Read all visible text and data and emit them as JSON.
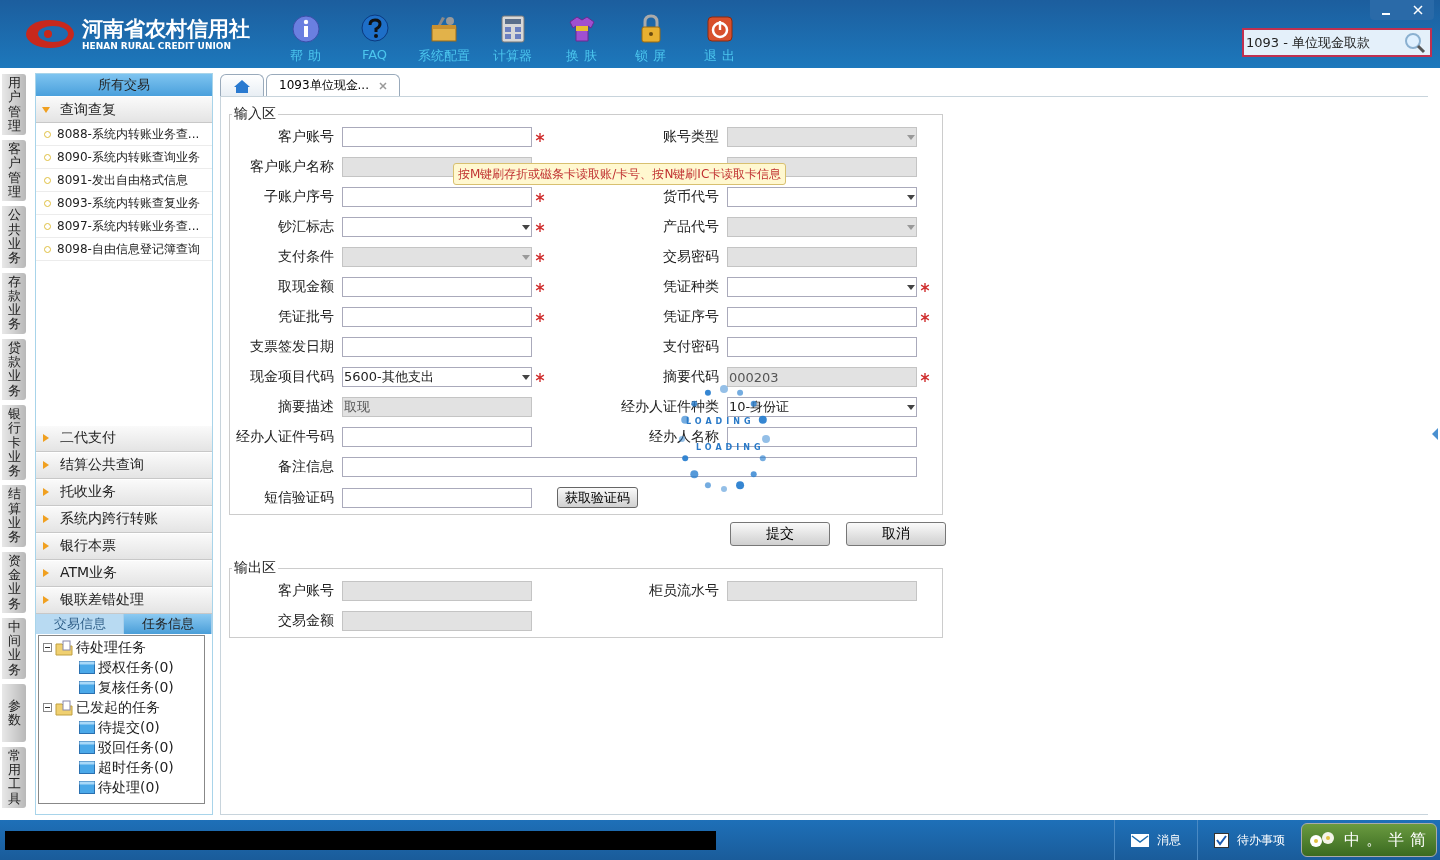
{
  "header": {
    "logo": {
      "title": "河南省农村信用社",
      "subtitle": "HENAN RURAL CREDIT UNION"
    },
    "toolbar": [
      {
        "kind": "info",
        "label": "帮 助"
      },
      {
        "kind": "faq",
        "label": "FAQ"
      },
      {
        "kind": "config",
        "label": "系统配置"
      },
      {
        "kind": "calculator",
        "label": "计算器"
      },
      {
        "kind": "skin",
        "label": "换 肤"
      },
      {
        "kind": "lock",
        "label": "锁 屏"
      },
      {
        "kind": "exit",
        "label": "退 出"
      }
    ],
    "search": {
      "value": "1093 - 单位现金取款"
    }
  },
  "nav_tabs": [
    "用户管理",
    "客户管理",
    "公共业务",
    "存款业务",
    "贷款业务",
    "银行卡业务",
    "结算业务",
    "资金业务",
    "中间业务",
    "参数",
    "常用工具"
  ],
  "sidebar": {
    "title": "所有交易",
    "groups": [
      {
        "label": "查询查复",
        "expanded": true,
        "items": [
          "8088-系统内转账业务查...",
          "8090-系统内转账查询业务",
          "8091-发出自由格式信息",
          "8093-系统内转账查复业务",
          "8097-系统内转账业务查...",
          "8098-自由信息登记簿查询"
        ]
      },
      {
        "label": "二代支付",
        "expanded": false
      },
      {
        "label": "结算公共查询",
        "expanded": false
      },
      {
        "label": "托收业务",
        "expanded": false
      },
      {
        "label": "系统内跨行转账",
        "expanded": false
      },
      {
        "label": "银行本票",
        "expanded": false
      },
      {
        "label": "ATM业务",
        "expanded": false
      },
      {
        "label": "银联差错处理",
        "expanded": false
      }
    ],
    "info_tabs": [
      {
        "label": "交易信息",
        "selected": false
      },
      {
        "label": "任务信息",
        "selected": true
      }
    ],
    "tree": [
      {
        "label": "待处理任务",
        "expanded": true,
        "children": [
          {
            "label": "授权任务(0)"
          },
          {
            "label": "复核任务(0)"
          }
        ]
      },
      {
        "label": "已发起的任务",
        "expanded": true,
        "children": [
          {
            "label": "待提交(0)"
          },
          {
            "label": "驳回任务(0)"
          },
          {
            "label": "超时任务(0)"
          },
          {
            "label": "待处理(0)"
          }
        ]
      }
    ]
  },
  "tabs": [
    {
      "kind": "home",
      "selected": false
    },
    {
      "kind": "page",
      "label": "1093单位现金...",
      "selected": true
    }
  ],
  "input_area": {
    "title": "输入区",
    "fields": [
      {
        "label": "客户账号",
        "kind": "text",
        "required": true,
        "disabled": false
      },
      {
        "label": "账号类型",
        "kind": "select",
        "required": false,
        "disabled": true
      },
      {
        "label": "客户账户名称",
        "kind": "text",
        "required": false,
        "disabled": true
      },
      {
        "kind": "text",
        "required": false,
        "disabled": true
      },
      {
        "label": "子账户序号",
        "kind": "text",
        "required": true,
        "disabled": false
      },
      {
        "label": "货币代号",
        "kind": "select",
        "required": false,
        "disabled": false
      },
      {
        "label": "钞汇标志",
        "kind": "select",
        "required": true,
        "disabled": false
      },
      {
        "label": "产品代号",
        "kind": "select",
        "required": false,
        "disabled": true
      },
      {
        "label": "支付条件",
        "kind": "select",
        "required": true,
        "disabled": true
      },
      {
        "label": "交易密码",
        "kind": "text",
        "required": false,
        "disabled": true
      },
      {
        "label": "取现金额",
        "kind": "text",
        "required": true,
        "disabled": false
      },
      {
        "label": "凭证种类",
        "kind": "select",
        "required": true,
        "disabled": false
      },
      {
        "label": "凭证批号",
        "kind": "text",
        "required": true,
        "disabled": false
      },
      {
        "label": "凭证序号",
        "kind": "text",
        "required": true,
        "disabled": false
      },
      {
        "label": "支票签发日期",
        "kind": "text",
        "required": false,
        "disabled": false
      },
      {
        "label": "支付密码",
        "kind": "text",
        "required": false,
        "disabled": false
      },
      {
        "label": "现金项目代码",
        "kind": "select",
        "value": "5600-其他支出",
        "required": true,
        "disabled": false
      },
      {
        "label": "摘要代码",
        "kind": "text",
        "value": "000203",
        "required": true,
        "disabled": true
      },
      {
        "label": "摘要描述",
        "kind": "text",
        "value": "取现",
        "required": false,
        "disabled": true
      },
      {
        "label": "经办人证件种类",
        "kind": "select",
        "value": "10-身份证",
        "required": false,
        "disabled": false
      },
      {
        "label": "经办人证件号码",
        "kind": "text",
        "required": false,
        "disabled": false
      },
      {
        "label": "经办人名称",
        "kind": "text",
        "required": false,
        "disabled": false
      },
      {
        "label": "备注信息",
        "kind": "wide",
        "required": false,
        "disabled": false
      },
      {
        "label": "短信验证码",
        "kind": "button",
        "button": "获取验证码",
        "required": false,
        "disabled": false
      }
    ],
    "tooltip": "按M键刷存折或磁条卡读取账/卡号、按N键刷IC卡读取卡信息"
  },
  "actions": [
    "提交",
    "取消"
  ],
  "output_area": {
    "title": "输出区",
    "fields": [
      {
        "label": "客户账号"
      },
      {
        "label": "柜员流水号"
      },
      {
        "label": "交易金额"
      }
    ]
  },
  "loading": [
    "LOADING",
    "LOADING"
  ],
  "status_bar": {
    "items": [
      {
        "kind": "mail",
        "label": "消息"
      },
      {
        "kind": "checkbox",
        "label": "待办事项"
      }
    ],
    "ime": [
      "中",
      "。",
      "半",
      "简"
    ]
  }
}
